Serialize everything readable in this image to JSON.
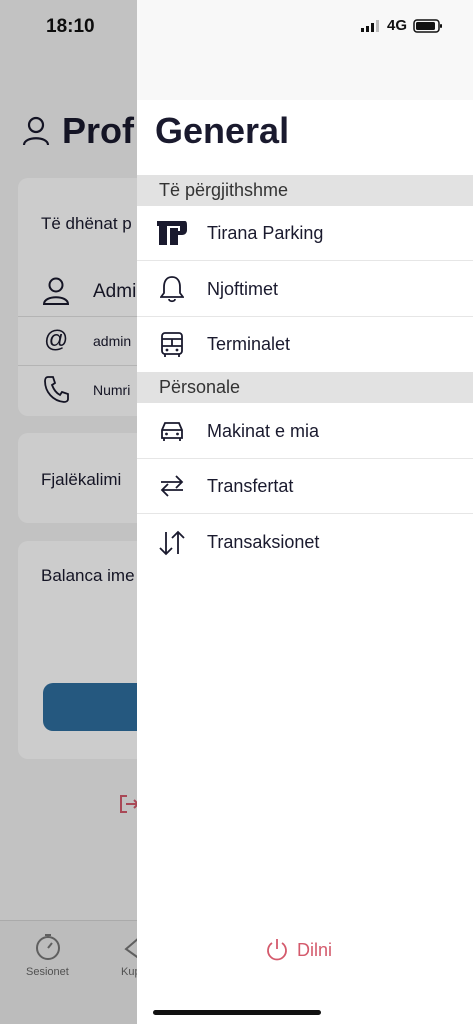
{
  "status": {
    "time": "18:10",
    "network": "4G"
  },
  "background": {
    "title": "Prof",
    "card1_heading": "Të dhënat p",
    "row_name": "Admi",
    "row_email": "admin",
    "row_phone": "Numri",
    "card2_heading": "Fjalëkalimi",
    "card3_heading": "Balanca ime",
    "tab_sessions": "Sesionet",
    "tab_second": "Kup"
  },
  "drawer": {
    "title": "General",
    "sections": [
      {
        "label": "Të përgjithshme",
        "items": [
          {
            "label": "Tirana Parking",
            "icon": "tirana-parking-logo-icon"
          },
          {
            "label": "Njoftimet",
            "icon": "bell-icon"
          },
          {
            "label": "Terminalet",
            "icon": "bus-icon"
          }
        ]
      },
      {
        "label": "Përsonale",
        "items": [
          {
            "label": "Makinat e mia",
            "icon": "car-icon"
          },
          {
            "label": "Transfertat",
            "icon": "transfer-arrows-icon"
          },
          {
            "label": "Transaksionet",
            "icon": "transactions-arrows-icon"
          }
        ]
      }
    ],
    "logout_label": "Dilni"
  },
  "colors": {
    "accent_blue": "#2f6f9f",
    "logout_red": "#d45a6c",
    "section_bg": "#e2e2e2"
  }
}
